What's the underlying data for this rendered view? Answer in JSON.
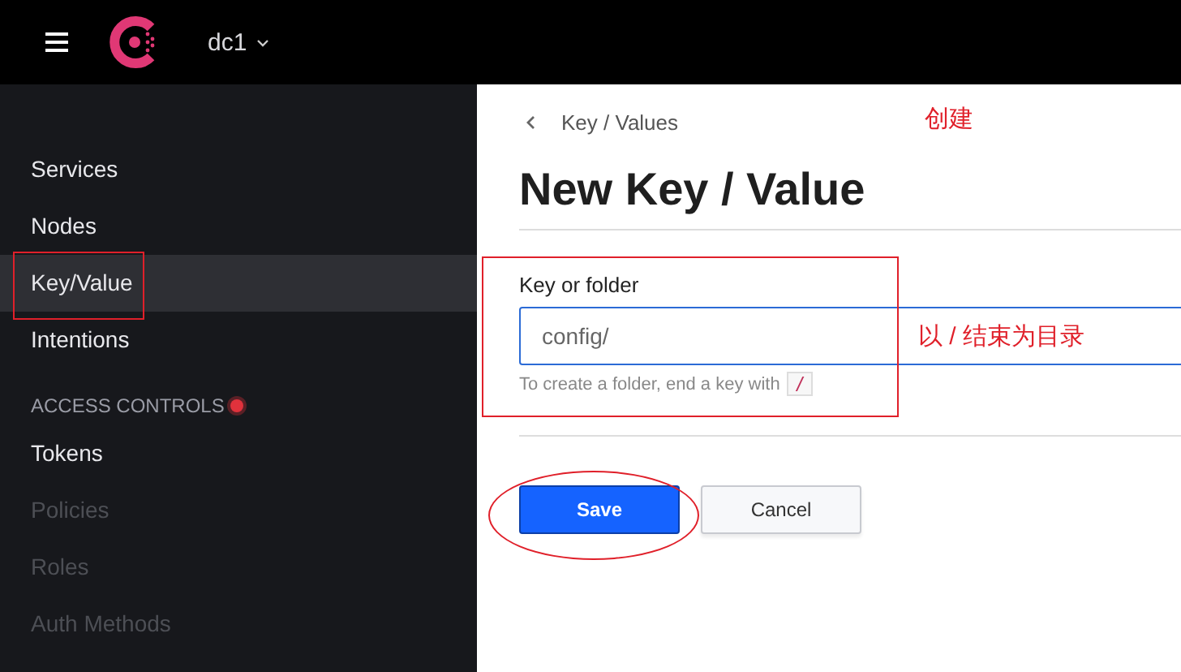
{
  "top_bar": {
    "datacenter": "dc1"
  },
  "sidebar": {
    "items": [
      {
        "label": "Services",
        "selected": false,
        "disabled": false
      },
      {
        "label": "Nodes",
        "selected": false,
        "disabled": false
      },
      {
        "label": "Key/Value",
        "selected": true,
        "disabled": false
      },
      {
        "label": "Intentions",
        "selected": false,
        "disabled": false
      }
    ],
    "section": {
      "title": "ACCESS CONTROLS",
      "items": [
        {
          "label": "Tokens",
          "selected": false,
          "disabled": false
        },
        {
          "label": "Policies",
          "selected": false,
          "disabled": true
        },
        {
          "label": "Roles",
          "selected": false,
          "disabled": true
        },
        {
          "label": "Auth Methods",
          "selected": false,
          "disabled": true
        }
      ]
    }
  },
  "breadcrumb": "Key / Values",
  "title": "New Key / Value",
  "form": {
    "label": "Key or folder",
    "value": "config/",
    "hint": "To create a folder, end a key with",
    "hint_code": "/"
  },
  "buttons": [
    {
      "label": "Save",
      "kind": "primary"
    },
    {
      "label": "Cancel",
      "kind": "secondary"
    }
  ],
  "annotations": [
    {
      "text": "创建"
    },
    {
      "text": "以 / 结束为目录"
    }
  ]
}
